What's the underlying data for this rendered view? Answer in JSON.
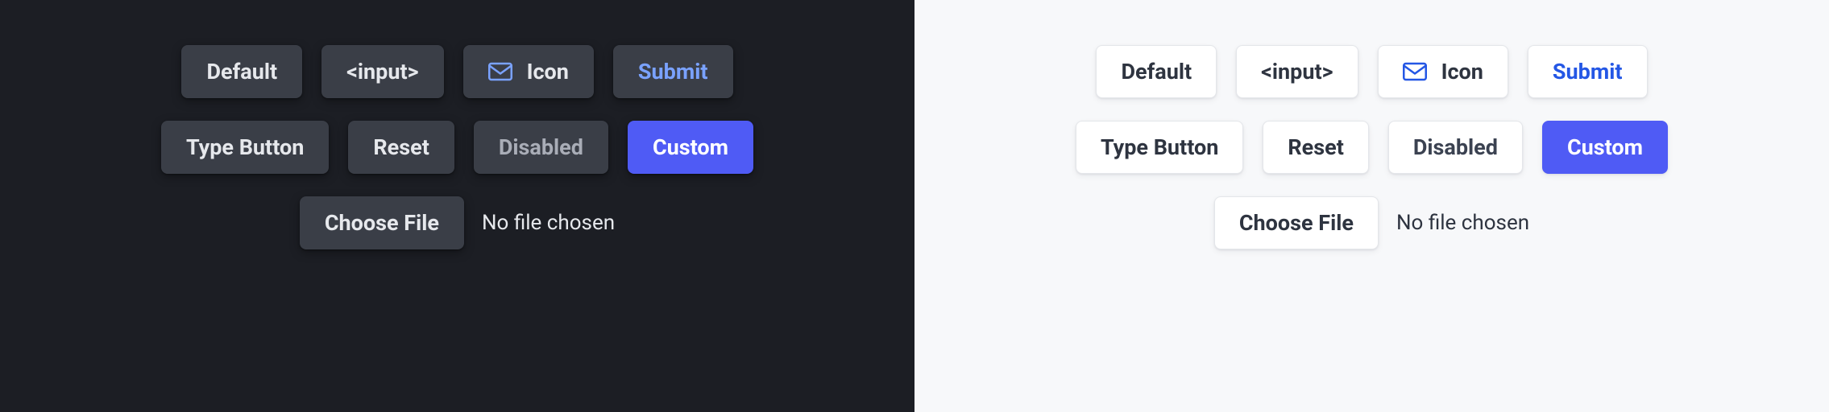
{
  "buttons": {
    "default": "Default",
    "input": "<input>",
    "icon": "Icon",
    "submit": "Submit",
    "type_button": "Type Button",
    "reset": "Reset",
    "disabled": "Disabled",
    "custom": "Custom",
    "choose_file": "Choose File"
  },
  "file_status": "No file chosen",
  "colors": {
    "dark_bg": "#1c1e24",
    "dark_btn": "#3a3e47",
    "light_bg": "#f7f8fa",
    "light_btn": "#ffffff",
    "accent_blue_dark": "#7aa2ff",
    "accent_blue_light": "#2457e5",
    "custom_btn": "#4f5bf5"
  },
  "icons": {
    "mail": "mail-icon"
  }
}
